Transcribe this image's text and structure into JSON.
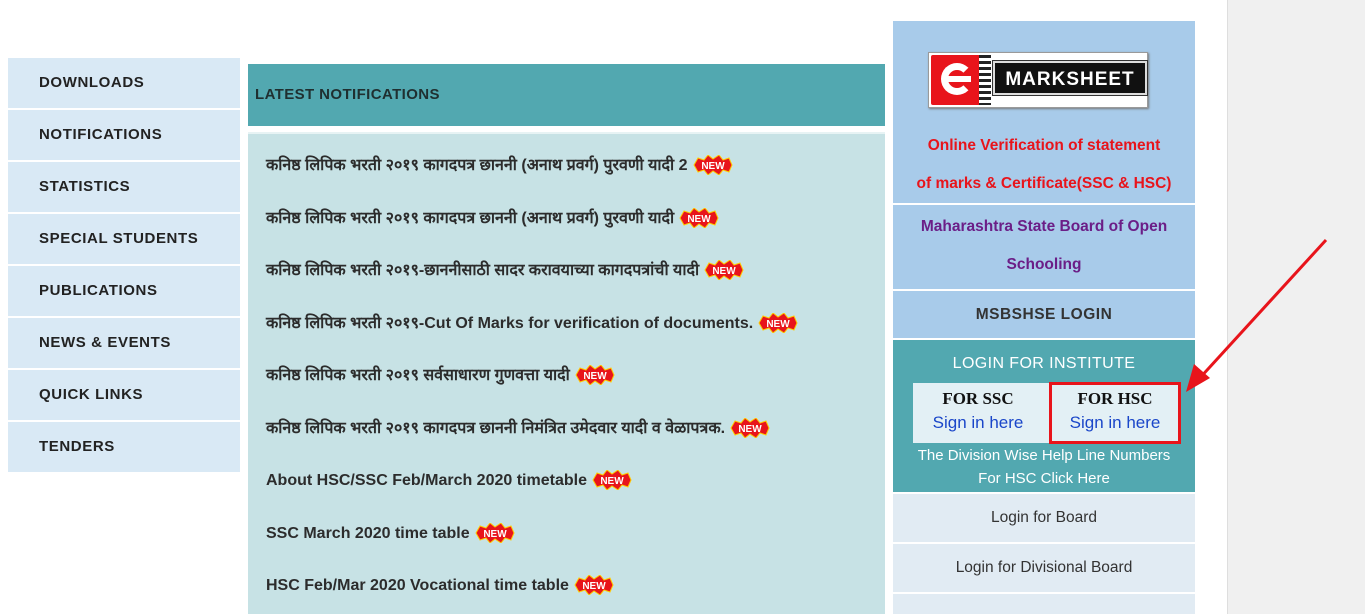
{
  "nav": {
    "items": [
      {
        "label": "DOWNLOADS"
      },
      {
        "label": "NOTIFICATIONS"
      },
      {
        "label": "STATISTICS"
      },
      {
        "label": "SPECIAL STUDENTS"
      },
      {
        "label": "PUBLICATIONS"
      },
      {
        "label": "NEWS & EVENTS"
      },
      {
        "label": "QUICK LINKS"
      },
      {
        "label": "TENDERS"
      }
    ]
  },
  "notifications": {
    "heading": "LATEST NOTIFICATIONS",
    "new_badge_text": "NEW",
    "items": [
      {
        "text": "कनिष्ठ लिपिक भरती २०१९ कागदपत्र छाननी (अनाथ प्रवर्ग) पुरवणी यादी 2"
      },
      {
        "text": "कनिष्ठ लिपिक भरती २०१९ कागदपत्र छाननी (अनाथ प्रवर्ग) पुरवणी यादी"
      },
      {
        "text": "कनिष्ठ लिपिक भरती २०१९-छाननीसाठी सादर करावयाच्या कागदपत्रांची यादी"
      },
      {
        "text": "कनिष्ठ लिपिक भरती २०१९-Cut Of Marks for verification of documents."
      },
      {
        "text": "कनिष्ठ लिपिक भरती २०१९ सर्वसाधारण गुणवत्ता यादी"
      },
      {
        "text": "कनिष्ठ लिपिक भरती २०१९ कागदपत्र छाननी निमंत्रित उमेदवार यादी व वेळापत्रक."
      },
      {
        "text": "About HSC/SSC Feb/March 2020 timetable"
      },
      {
        "text": "SSC March 2020 time table"
      },
      {
        "text": "HSC Feb/Mar 2020 Vocational time table"
      }
    ]
  },
  "emarksheet": {
    "logo_text": "MARKSHEET",
    "verify_line1": "Online Verification of statement",
    "verify_line2": "of marks & Certificate(SSC & HSC)"
  },
  "msos": {
    "line1": "Maharashtra State Board of Open",
    "line2": "Schooling"
  },
  "msbshse_login": "MSBSHSE LOGIN",
  "institute": {
    "title": "LOGIN FOR INSTITUTE",
    "ssc_label": "FOR SSC",
    "ssc_link": "Sign in here",
    "hsc_label": "FOR HSC",
    "hsc_link": "Sign in here",
    "help_line1": "The Division Wise Help Line Numbers",
    "help_line2": "For HSC Click Here"
  },
  "board_links": [
    {
      "label": "Login for Board"
    },
    {
      "label": "Login for Divisional Board"
    }
  ],
  "colors": {
    "nav_bg": "#d9e9f5",
    "teal": "#52a8b0",
    "notif_bg": "#c7e2e5",
    "right_blue": "#a8cbea",
    "red": "#e8141b",
    "link_blue": "#1a46c9",
    "purple": "#6b1e87"
  }
}
